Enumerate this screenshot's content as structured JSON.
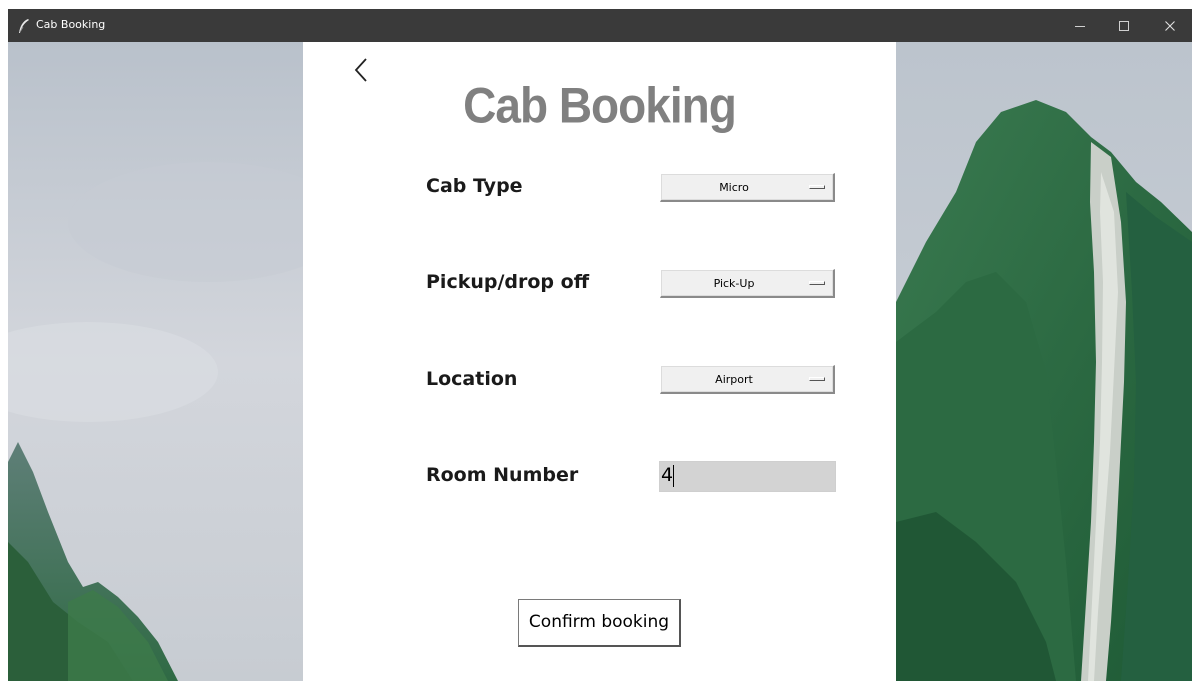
{
  "window": {
    "title": "Cab Booking",
    "controls": {
      "minimize": "–",
      "maximize": "☐",
      "close": "✕"
    }
  },
  "panel": {
    "heading": "Cab Booking",
    "fields": {
      "cab_type": {
        "label": "Cab Type",
        "value": "Micro"
      },
      "pickup": {
        "label": "Pickup/drop off",
        "value": "Pick-Up"
      },
      "location": {
        "label": "Location",
        "value": "Airport"
      },
      "room": {
        "label": "Room Number",
        "value": "4"
      }
    },
    "confirm_label": "Confirm booking"
  },
  "colors": {
    "titlebar": "#3a3a3a",
    "heading": "#808080",
    "entry_bg": "#d3d3d3",
    "mountain_dark": "#1f5e3a",
    "mountain_light": "#3a8a4a"
  },
  "icons": {
    "app": "feather-icon",
    "back": "chevron-left-icon"
  }
}
